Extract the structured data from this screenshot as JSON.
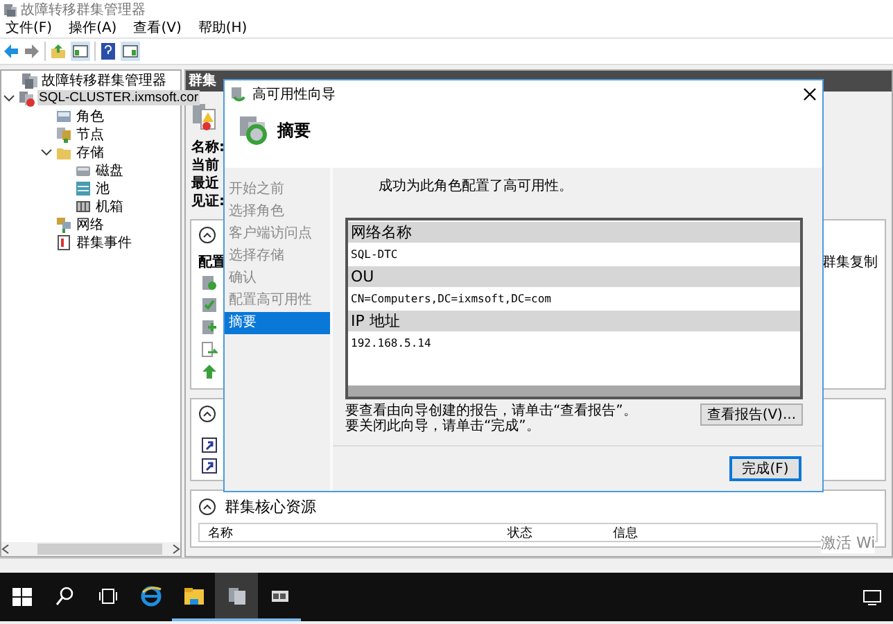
{
  "window": {
    "title": "故障转移群集管理器"
  },
  "menu": [
    "文件(F)",
    "操作(A)",
    "查看(V)",
    "帮助(H)"
  ],
  "tree": [
    {
      "label": "故障转移群集管理器",
      "kind": "manager",
      "selected": false,
      "children": [
        {
          "label": "SQL-CLUSTER.ixmsoft.cor",
          "kind": "cluster",
          "selected": true,
          "expanded": true,
          "children": [
            {
              "label": "角色",
              "kind": "roles",
              "selected": false
            },
            {
              "label": "节点",
              "kind": "nodes",
              "selected": false
            },
            {
              "label": "存储",
              "kind": "folder",
              "selected": false,
              "expanded": true,
              "children": [
                {
                  "label": "磁盘",
                  "kind": "disk",
                  "selected": false
                },
                {
                  "label": "池",
                  "kind": "pool",
                  "selected": false
                },
                {
                  "label": "机箱",
                  "kind": "enclosure",
                  "selected": false
                }
              ]
            },
            {
              "label": "网络",
              "kind": "network",
              "selected": false
            },
            {
              "label": "群集事件",
              "kind": "events",
              "selected": false
            }
          ]
        }
      ]
    }
  ],
  "content": {
    "header": "群集",
    "details": [
      "名称:",
      "当前",
      "最近",
      "见证:"
    ],
    "panels": [
      {
        "kind": "tasks",
        "subtitle": "配置",
        "side_text": "群集复制"
      },
      {
        "kind": "navigate"
      },
      {
        "kind": "resources",
        "title": "群集核心资源",
        "columns": [
          "名称",
          "状态",
          "信息"
        ]
      }
    ]
  },
  "activation_notice": "激活 Wi",
  "dialog": {
    "title": "高可用性向导",
    "heading": "摘要",
    "steps": [
      {
        "label": "开始之前",
        "selected": false
      },
      {
        "label": "选择角色",
        "selected": false
      },
      {
        "label": "客户端访问点",
        "selected": false
      },
      {
        "label": "选择存储",
        "selected": false
      },
      {
        "label": "确认",
        "selected": false
      },
      {
        "label": "配置高可用性",
        "selected": false
      },
      {
        "label": "摘要",
        "selected": true
      }
    ],
    "message": "成功为此角色配置了高可用性。",
    "report": [
      {
        "heading": "网络名称",
        "value": "SQL-DTC"
      },
      {
        "heading": "OU",
        "value": "CN=Computers,DC=ixmsoft,DC=com"
      },
      {
        "heading": "IP 地址",
        "value": "192.168.5.14"
      }
    ],
    "hints": [
      "要查看由向导创建的报告，请单击“查看报告”。",
      "要关闭此向导，请单击“完成”。"
    ],
    "view_report_button": "查看报告(V)...",
    "finish_button": "完成(F)"
  },
  "taskbar": [
    {
      "kind": "start",
      "running": false,
      "selected": false
    },
    {
      "kind": "search",
      "running": false,
      "selected": false
    },
    {
      "kind": "taskview",
      "running": false,
      "selected": false
    },
    {
      "kind": "browser",
      "running": false,
      "selected": false
    },
    {
      "kind": "explorer",
      "running": true,
      "selected": false
    },
    {
      "kind": "cluster",
      "running": true,
      "selected": true
    },
    {
      "kind": "server",
      "running": true,
      "selected": false
    }
  ]
}
